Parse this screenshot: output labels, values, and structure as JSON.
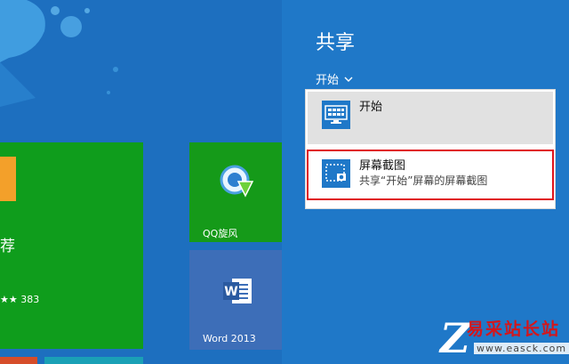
{
  "start": {
    "store_label": "荐",
    "store_rating": "★★ 383",
    "qq_label": "QQ旋风",
    "word_label": "Word 2013",
    "word_icon_letter": "W"
  },
  "share": {
    "title": "共享",
    "source_selector": "开始",
    "items": [
      {
        "label": "开始",
        "sub": ""
      },
      {
        "label": "屏幕截图",
        "sub": "共享“开始”屏幕的屏幕截图"
      }
    ]
  },
  "watermark": {
    "text": "易采站长站",
    "url": "www.easck.com"
  },
  "colors": {
    "charm_bg": "#1f78c8",
    "start_bg": "#1d6fbf",
    "highlight_border": "#e0131a"
  }
}
